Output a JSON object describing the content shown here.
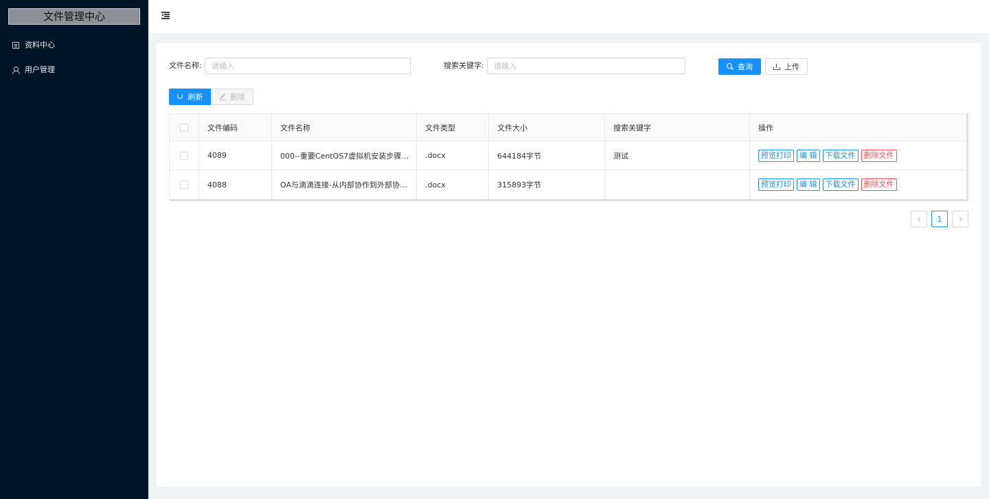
{
  "app": {
    "title": "文件管理中心"
  },
  "sidebar": {
    "items": [
      {
        "label": "资料中心",
        "icon": "book-icon"
      },
      {
        "label": "用户管理",
        "icon": "user-icon"
      }
    ]
  },
  "header": {
    "toggle_icon": "menu-fold-icon"
  },
  "search": {
    "filename_label": "文件名称:",
    "filename_placeholder": "请输入",
    "filename_value": "",
    "keyword_label": "搜索关键字:",
    "keyword_placeholder": "请输入",
    "keyword_value": "",
    "query_label": "查询",
    "upload_label": "上传"
  },
  "toolbar": {
    "refresh_label": "刷新",
    "delete_label": "删除"
  },
  "table": {
    "columns": [
      "文件编码",
      "文件名称",
      "文件类型",
      "文件大小",
      "搜索关键字",
      "操作"
    ],
    "rows": [
      {
        "code": "4089",
        "name": "000--重要CentOS7虚拟机安装步骤.d...",
        "type": ".docx",
        "size": "644184字节",
        "keyword": "测试"
      },
      {
        "code": "4088",
        "name": "OA与滴滴连接-从内部协作到外部协作...",
        "type": ".docx",
        "size": "315893字节",
        "keyword": ""
      }
    ],
    "actions": {
      "preview": "预览打印",
      "edit": "编 辑",
      "download": "下载文件",
      "delete": "删除文件"
    }
  },
  "pagination": {
    "current": "1"
  },
  "colors": {
    "primary": "#1890ff",
    "danger": "#ff4d4f",
    "sidebar": "#011529"
  }
}
